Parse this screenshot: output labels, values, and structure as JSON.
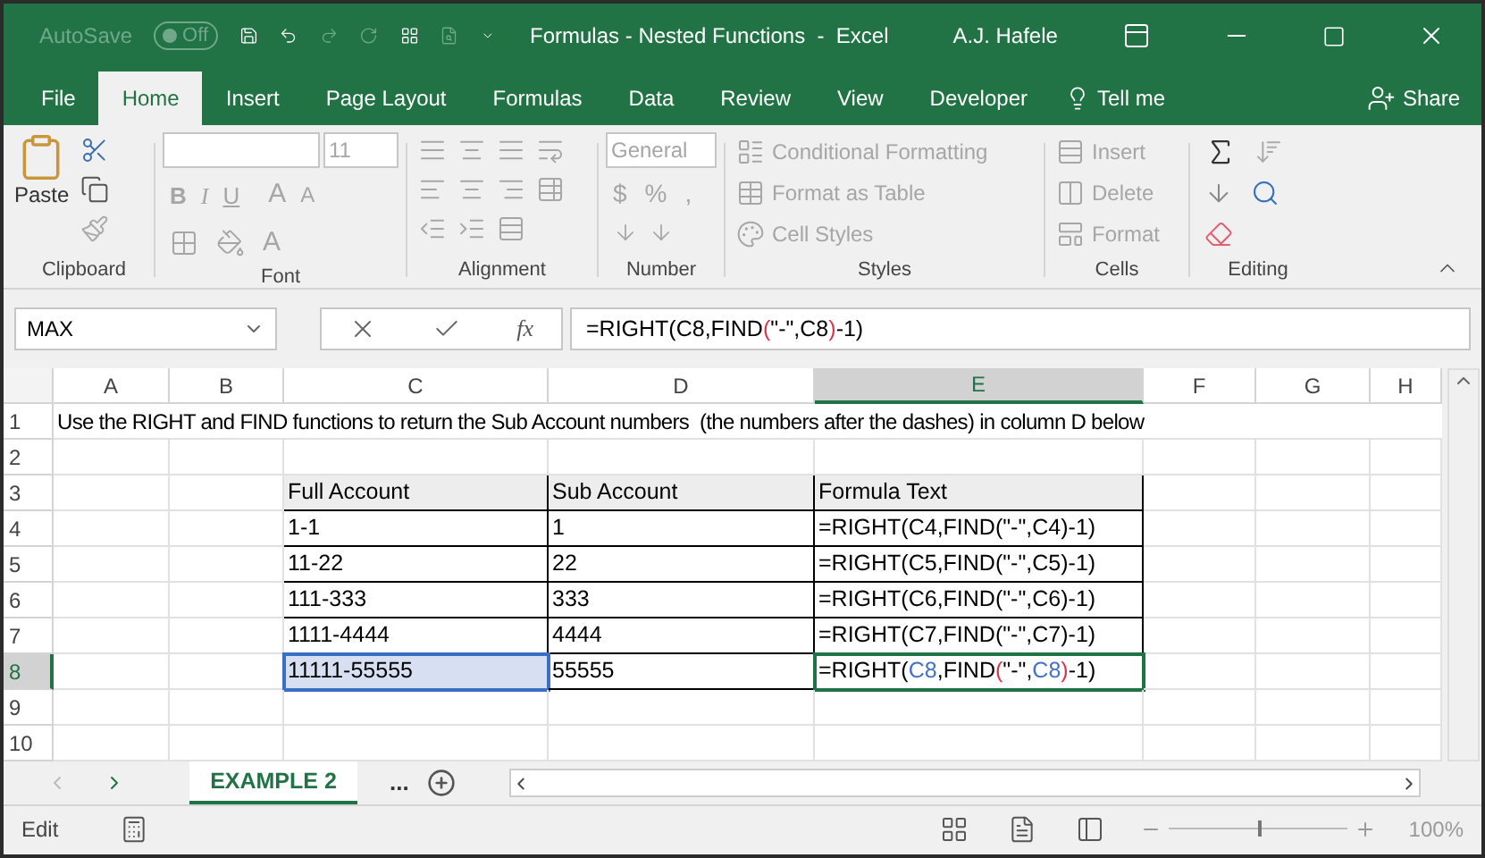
{
  "title_bar": {
    "autosave": {
      "label": "AutoSave",
      "toggle": "Off",
      "on": false
    },
    "title": "Formulas - Nested Functions  -  Excel",
    "user": "A.J. Hafele"
  },
  "tabs": [
    {
      "label": "File",
      "selected": false
    },
    {
      "label": "Home",
      "selected": true
    },
    {
      "label": "Insert",
      "selected": false
    },
    {
      "label": "Page Layout",
      "selected": false
    },
    {
      "label": "Formulas",
      "selected": false
    },
    {
      "label": "Data",
      "selected": false
    },
    {
      "label": "Review",
      "selected": false
    },
    {
      "label": "View",
      "selected": false
    },
    {
      "label": "Developer",
      "selected": false
    }
  ],
  "tell_me": "Tell me",
  "share": "Share",
  "ribbon": {
    "disabled": true,
    "clipboard": {
      "paste": "Paste",
      "label": "Clipboard"
    },
    "font": {
      "font_size": "11",
      "bold": "B",
      "italic": "I",
      "underline": "U",
      "grow": "A",
      "shrink": "A",
      "font_color": "A",
      "label": "Font"
    },
    "alignment": {
      "label": "Alignment"
    },
    "number": {
      "format": "General",
      "symbols": [
        "$",
        "%",
        ","
      ],
      "label": "Number"
    },
    "styles": {
      "items": [
        "Conditional Formatting",
        "Format as Table",
        "Cell Styles"
      ],
      "label": "Styles"
    },
    "cells": {
      "items": [
        "Insert",
        "Delete",
        "Format"
      ],
      "label": "Cells"
    },
    "editing": {
      "label": "Editing"
    }
  },
  "formula_bar": {
    "name_box": "MAX",
    "fx": "fx",
    "formula": [
      {
        "text": "=RIGHT(C8,FIND",
        "color": "#000000"
      },
      {
        "text": "(",
        "color": "#e0314a"
      },
      {
        "text": "\"-\",C8",
        "color": "#000000"
      },
      {
        "text": ")",
        "color": "#e0314a"
      },
      {
        "text": "-1)",
        "color": "#000000"
      }
    ]
  },
  "columns": [
    {
      "label": "A",
      "selected": false
    },
    {
      "label": "B",
      "selected": false
    },
    {
      "label": "C",
      "selected": false
    },
    {
      "label": "D",
      "selected": false
    },
    {
      "label": "E",
      "selected": true
    },
    {
      "label": "F",
      "selected": false
    },
    {
      "label": "G",
      "selected": false
    },
    {
      "label": "H",
      "selected": false
    }
  ],
  "rows": [
    {
      "label": "1",
      "selected": false
    },
    {
      "label": "2",
      "selected": false
    },
    {
      "label": "3",
      "selected": false
    },
    {
      "label": "4",
      "selected": false
    },
    {
      "label": "5",
      "selected": false
    },
    {
      "label": "6",
      "selected": false
    },
    {
      "label": "7",
      "selected": false
    },
    {
      "label": "8",
      "selected": true
    },
    {
      "label": "9",
      "selected": false
    },
    {
      "label": "10",
      "selected": false
    }
  ],
  "note": "Use the RIGHT and FIND functions to return the Sub Account numbers  (the numbers after the dashes) in column D below",
  "table": {
    "headers": [
      "Full Account",
      "Sub Account",
      "Formula Text"
    ],
    "rows": [
      {
        "cells": [
          {
            "text": "1-1",
            "selected": false,
            "editing": false
          },
          {
            "text": "1",
            "selected": false,
            "editing": false
          },
          {
            "text": "=RIGHT(C4,FIND(\"-\",C4)-1)",
            "selected": false,
            "editing": false
          }
        ]
      },
      {
        "cells": [
          {
            "text": "11-22",
            "selected": false,
            "editing": false
          },
          {
            "text": "22",
            "selected": false,
            "editing": false
          },
          {
            "text": "=RIGHT(C5,FIND(\"-\",C5)-1)",
            "selected": false,
            "editing": false
          }
        ]
      },
      {
        "cells": [
          {
            "text": "111-333",
            "selected": false,
            "editing": false
          },
          {
            "text": "333",
            "selected": false,
            "editing": false
          },
          {
            "text": "=RIGHT(C6,FIND(\"-\",C6)-1)",
            "selected": false,
            "editing": false
          }
        ]
      },
      {
        "cells": [
          {
            "text": "1111-4444",
            "selected": false,
            "editing": false
          },
          {
            "text": "4444",
            "selected": false,
            "editing": false
          },
          {
            "text": "=RIGHT(C7,FIND(\"-\",C7)-1)",
            "selected": false,
            "editing": false
          }
        ]
      },
      {
        "cells": [
          {
            "text": "11111-55555",
            "selected": true,
            "editing": false
          },
          {
            "text": "55555",
            "selected": false,
            "editing": false
          },
          {
            "segments": [
              {
                "text": "=RIGHT(",
                "color": "#000000"
              },
              {
                "text": "C8",
                "color": "#4472c4"
              },
              {
                "text": ",FIND",
                "color": "#000000"
              },
              {
                "text": "(",
                "color": "#e0314a"
              },
              {
                "text": "\"-\",",
                "color": "#000000"
              },
              {
                "text": "C8",
                "color": "#4472c4"
              },
              {
                "text": ")",
                "color": "#e0314a"
              },
              {
                "text": "-1)",
                "color": "#000000"
              }
            ],
            "selected": false,
            "editing": true
          }
        ]
      }
    ]
  },
  "sheet_tabs": [
    {
      "label": "EXAMPLE 2",
      "selected": true
    }
  ],
  "more_sheets": "...",
  "status_bar": {
    "mode": "Edit",
    "zoom": "100%",
    "level": 0.5
  }
}
